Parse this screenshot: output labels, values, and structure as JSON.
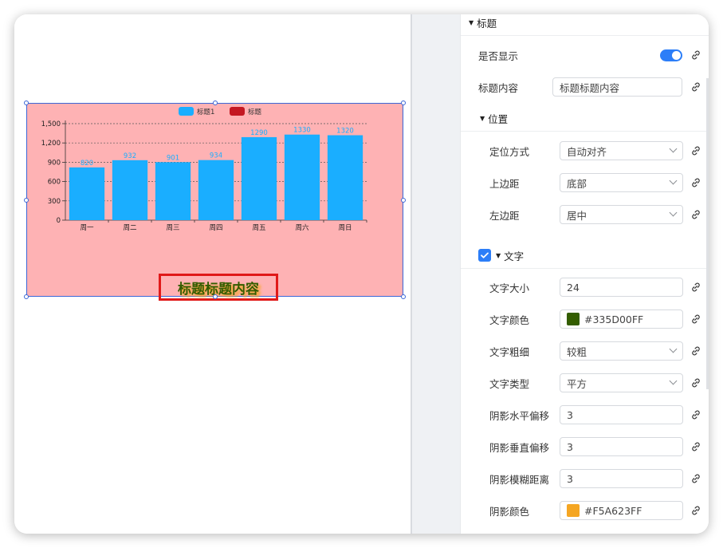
{
  "chart_data": {
    "type": "bar",
    "categories": [
      "周一",
      "周二",
      "周三",
      "周四",
      "周五",
      "周六",
      "周日"
    ],
    "series": [
      {
        "name": "标题1",
        "values": [
          820,
          932,
          901,
          934,
          1290,
          1330,
          1320
        ],
        "color": "#1aaeff"
      },
      {
        "name": "标题",
        "values": [],
        "color": "#c41822"
      }
    ],
    "ylim": [
      0,
      1500
    ],
    "yticks": [
      "0",
      "300",
      "600",
      "900",
      "1,200",
      "1,500"
    ],
    "data_labels": [
      "820",
      "932",
      "901",
      "934",
      "1290",
      "1330",
      "1320"
    ],
    "grid": true,
    "legend": "top-center"
  },
  "chart_title": "标题标题内容",
  "panel": {
    "section_title": "标题",
    "show_label": "是否显示",
    "content_label": "标题内容",
    "content_value": "标题标题内容",
    "position_section": "位置",
    "mode_label": "定位方式",
    "mode_value": "自动对齐",
    "top_label": "上边距",
    "top_value": "底部",
    "left_label": "左边距",
    "left_value": "居中",
    "text_section": "文字",
    "size_label": "文字大小",
    "size_value": "24",
    "color_label": "文字颜色",
    "color_value": "#335D00FF",
    "color_swatch": "#335D00",
    "weight_label": "文字粗细",
    "weight_value": "较粗",
    "type_label": "文字类型",
    "type_value": "平方",
    "shadow_x_label": "阴影水平偏移",
    "shadow_x_value": "3",
    "shadow_y_label": "阴影垂直偏移",
    "shadow_y_value": "3",
    "shadow_blur_label": "阴影模糊距离",
    "shadow_blur_value": "3",
    "shadow_color_label": "阴影颜色",
    "shadow_color_value": "#F5A623FF",
    "shadow_swatch": "#F5A623"
  }
}
